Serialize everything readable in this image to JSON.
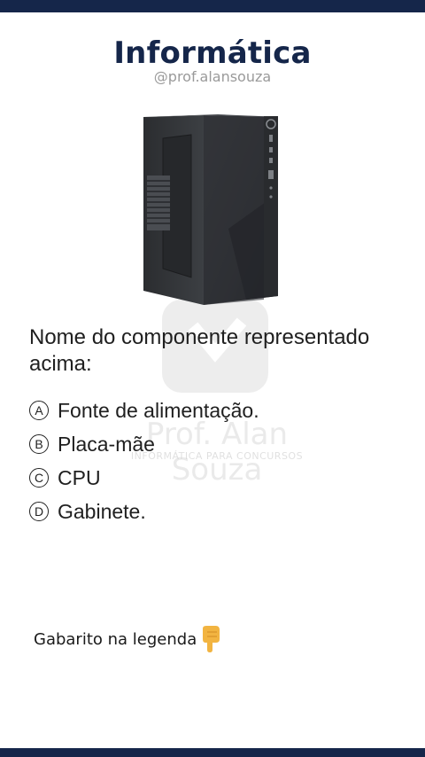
{
  "header": {
    "title": "Informática",
    "handle": "@prof.alansouza"
  },
  "watermark": {
    "name": "Prof. Alan Souza",
    "tagline": "INFORMÁTICA PARA CONCURSOS"
  },
  "question": {
    "text": "Nome do componente representado acima:"
  },
  "options": [
    {
      "letter": "A",
      "text": "Fonte de alimentação."
    },
    {
      "letter": "B",
      "text": "Placa-mãe"
    },
    {
      "letter": "C",
      "text": "CPU"
    },
    {
      "letter": "D",
      "text": "Gabinete."
    }
  ],
  "footer": {
    "answer_note": "Gabarito na legenda",
    "icon": "pointing-down-hand-icon"
  },
  "colors": {
    "brand": "#15264a",
    "text": "#1f1f1f",
    "handle": "#9a9a9a"
  }
}
